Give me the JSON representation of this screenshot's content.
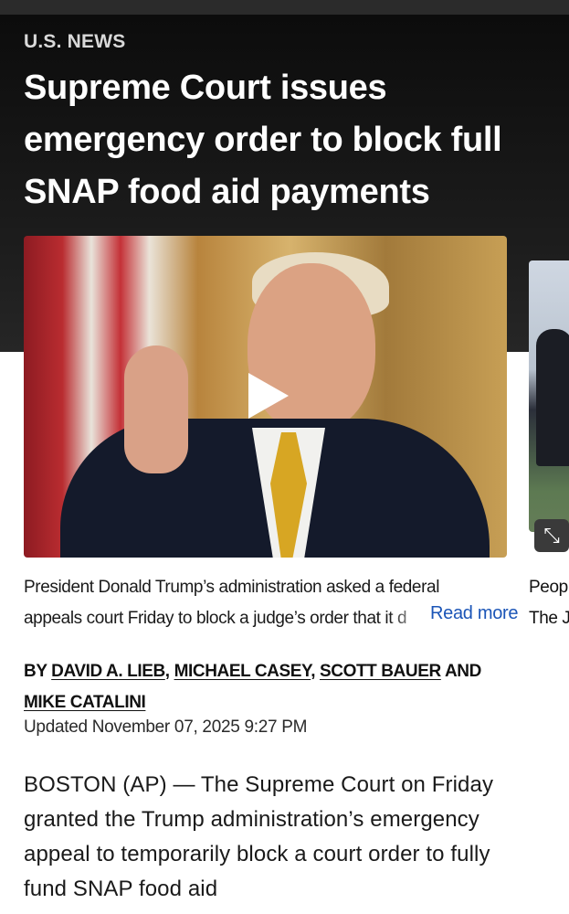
{
  "section": "U.S. NEWS",
  "headline": "Supreme Court issues emergency order to block full SNAP food aid payments",
  "media": {
    "play_icon": "play-icon",
    "expand_icon": "expand-icon"
  },
  "caption": {
    "line1": "President Donald Trump’s administration asked a federal",
    "line2": "appeals court Friday to block a judge’s order that it d",
    "read_more": "Read more"
  },
  "side_caption": {
    "line1": "Peopl",
    "line2": "The J"
  },
  "byline": {
    "prefix": "BY",
    "authors": [
      "DAVID A. LIEB",
      "MICHAEL CASEY",
      "SCOTT BAUER",
      "MIKE CATALINI"
    ],
    "and": "AND"
  },
  "updated": "Updated November 07, 2025 9:27 PM",
  "body": "BOSTON (AP) — The Supreme Court on Friday granted the Trump administration’s emergency appeal to temporarily block a court order to fully fund SNAP food aid",
  "colors": {
    "link": "#1b55b7",
    "hero_bg": "#111111"
  }
}
